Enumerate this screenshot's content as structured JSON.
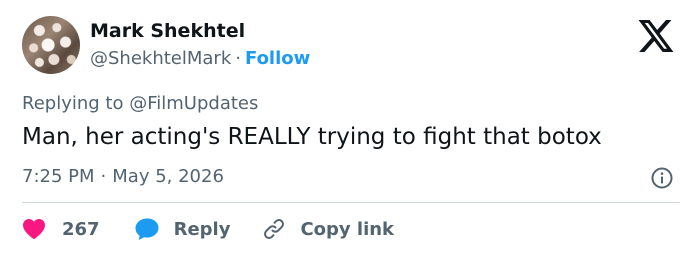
{
  "author": {
    "name": "Mark Shekhtel",
    "handle": "@ShekhtelMark",
    "separator": "·",
    "follow_label": "Follow"
  },
  "reply_context": {
    "prefix": "Replying to",
    "mention": "@FilmUpdates"
  },
  "tweet": {
    "text": "Man, her acting's REALLY trying to fight that botox",
    "time": "7:25 PM",
    "separator": "·",
    "date": "May 5, 2026"
  },
  "actions": {
    "like_count": "267",
    "reply_label": "Reply",
    "copy_label": "Copy link"
  },
  "icons": {
    "logo": "x-logo-icon",
    "info": "info-icon",
    "like": "heart-icon",
    "reply": "speech-bubble-icon",
    "copy": "link-icon"
  },
  "colors": {
    "accent": "#1d9bf0",
    "like": "#f91880",
    "text": "#0f1419",
    "muted": "#536471",
    "divider": "#cfd9de"
  }
}
